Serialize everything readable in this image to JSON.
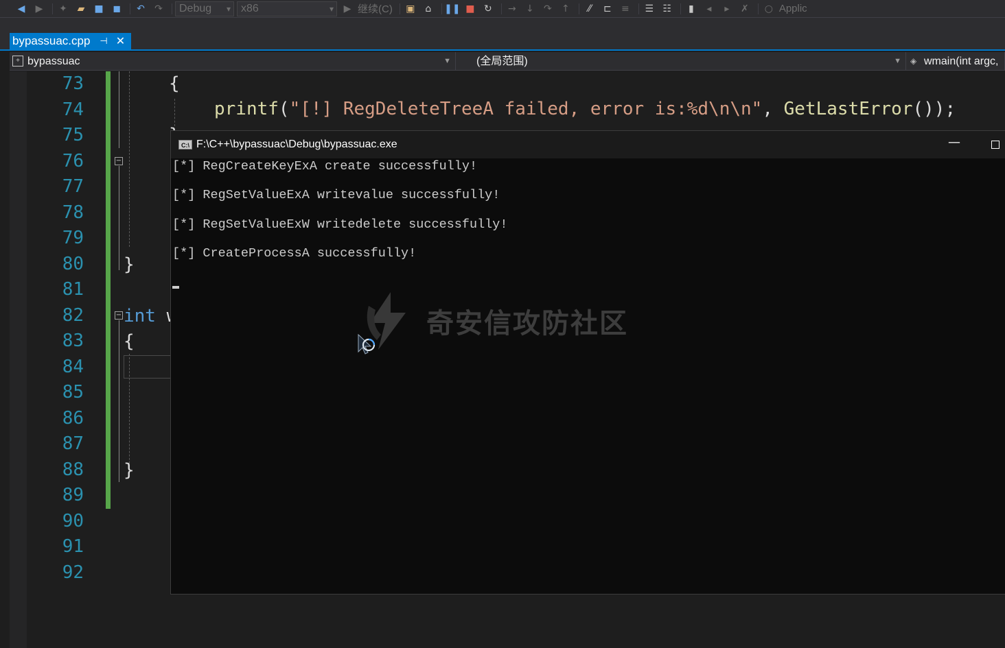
{
  "toolbar": {
    "config_value": "Debug",
    "platform_value": "x86",
    "continue_label": "继续(C)",
    "app_insights_label": "Applic"
  },
  "tab": {
    "filename": "bypassuac.cpp",
    "pin_glyph": "⊣",
    "close_glyph": "✕"
  },
  "navbar": {
    "project": "bypassuac",
    "scope": "(全局范围)",
    "function": "wmain(int argc,"
  },
  "editor": {
    "line_numbers": [
      "73",
      "74",
      "75",
      "76",
      "77",
      "78",
      "79",
      "80",
      "81",
      "82",
      "83",
      "84",
      "85",
      "86",
      "87",
      "88",
      "89",
      "90",
      "91",
      "92"
    ],
    "code": {
      "line73_brace": "{",
      "line74_func": "printf",
      "line74_open": "(",
      "line74_string": "\"[!] RegDeleteTreeA failed, error is:%d\\n\\n\"",
      "line74_comma": ", ",
      "line74_call": "GetLastError",
      "line74_close": "());",
      "line75_brace": "}",
      "line80_brace": "}",
      "line82_keyword": "int",
      "line82_rest": " w",
      "line83_brace": "{",
      "line88_brace": "}"
    }
  },
  "console": {
    "title": "F:\\C++\\bypassuac\\Debug\\bypassuac.exe",
    "icon_label": "C:\\",
    "minimize_glyph": "—",
    "lines": [
      "[*] RegCreateKeyExA create successfully!",
      "[*] RegSetValueExA writevalue successfully!",
      "[*] RegSetValueExW writedelete successfully!",
      "[*] CreateProcessA successfully!"
    ]
  },
  "watermark": {
    "text": "奇安信攻防社区"
  },
  "colors": {
    "accent": "#007acc",
    "line_number": "#2b91af",
    "keyword": "#569cd6",
    "string": "#d69d85",
    "function": "#dcdcaa",
    "change_bar": "#57a64a"
  }
}
